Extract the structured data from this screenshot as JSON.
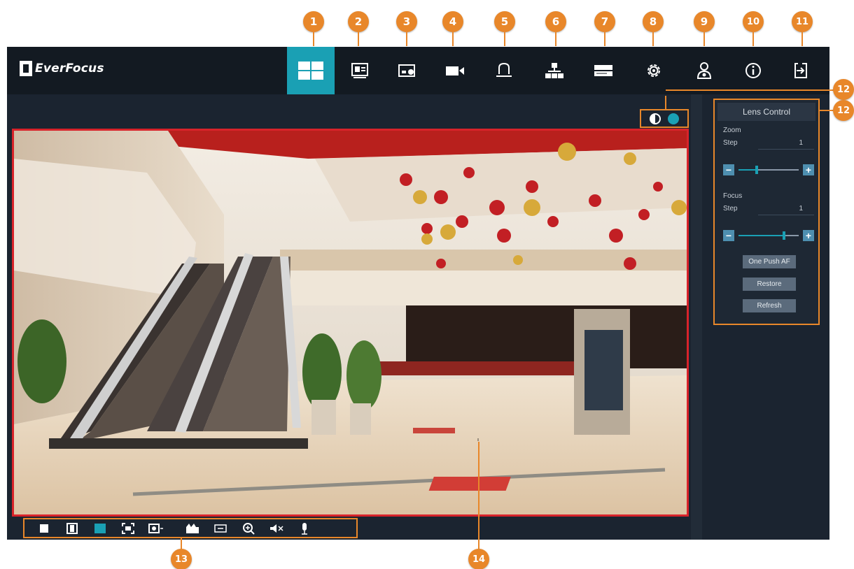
{
  "brand": {
    "logo_text": "EverFocus"
  },
  "callouts": [
    "1",
    "2",
    "3",
    "4",
    "5",
    "6",
    "7",
    "8",
    "9",
    "10",
    "11",
    "12",
    "12",
    "13",
    "14"
  ],
  "nav": {
    "items": [
      {
        "icon": "live-view-grid-icon",
        "active": true
      },
      {
        "icon": "playback-icon"
      },
      {
        "icon": "picture-icon"
      },
      {
        "icon": "camera-icon"
      },
      {
        "icon": "alarm-bell-icon"
      },
      {
        "icon": "network-icon"
      },
      {
        "icon": "storage-icon"
      },
      {
        "icon": "settings-gear-icon"
      },
      {
        "icon": "user-maintenance-icon"
      },
      {
        "icon": "info-icon"
      },
      {
        "icon": "logout-icon"
      }
    ]
  },
  "lens_control": {
    "title": "Lens Control",
    "zoom_label": "Zoom",
    "zoom_step_label": "Step",
    "zoom_step_value": "1",
    "zoom_level": 0.3,
    "focus_label": "Focus",
    "focus_step_label": "Step",
    "focus_step_value": "1",
    "focus_level": 0.75,
    "minus": "−",
    "plus": "+",
    "buttons": [
      "One Push AF",
      "Restore",
      "Refresh"
    ]
  },
  "colors": {
    "accent": "#1aa0b4",
    "callout": "#e8872a",
    "frame": "#d8232a",
    "bar": "#131a22"
  }
}
